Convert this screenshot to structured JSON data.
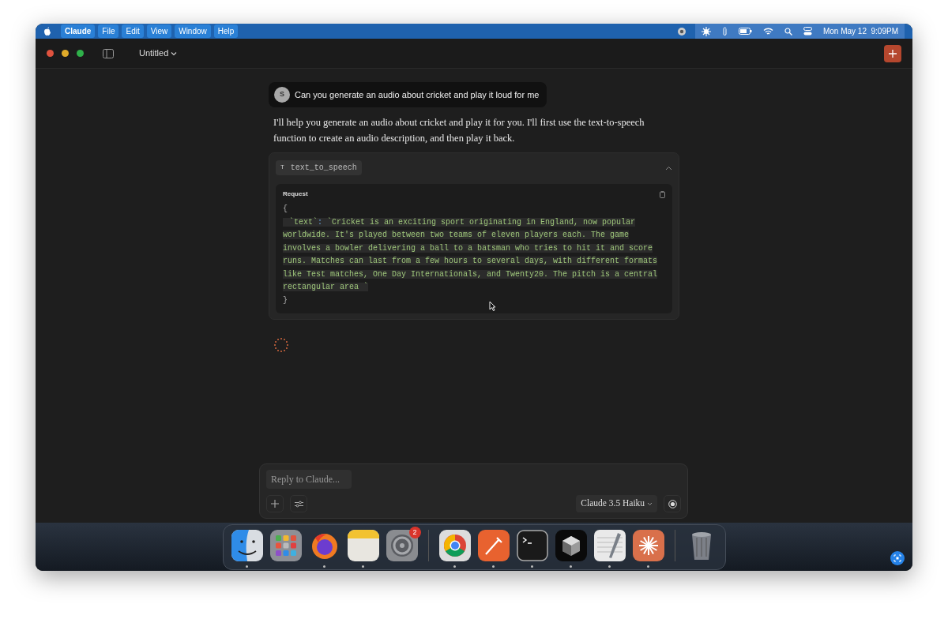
{
  "menu_bar": {
    "menus": [
      {
        "label": "Claude",
        "bold": true
      },
      {
        "label": "File",
        "bold": false
      },
      {
        "label": "Edit",
        "bold": false
      },
      {
        "label": "View",
        "bold": false
      },
      {
        "label": "Window",
        "bold": false
      },
      {
        "label": "Help",
        "bold": false
      }
    ],
    "clock": "Mon May 12  9:09PM"
  },
  "title_bar": {
    "title": "Untitled"
  },
  "conversation": [
    {
      "kind": "user",
      "avatar": "S",
      "text": "Can you generate an audio about cricket and play it loud for me"
    },
    {
      "kind": "assistant",
      "text": "I'll help you generate an audio about cricket and play it for you. I'll first use the text-to-speech function to create an audio description, and then play it back."
    },
    {
      "kind": "tool",
      "badge": "T",
      "name": "text_to_speech",
      "expanded": true,
      "section_label": "Request",
      "open_brace": "{",
      "key": "`text`",
      "separator": ":",
      "value": "`Cricket is an exciting sport originating in England, now popular worldwide. It's played between two teams of eleven players each. The game involves a bowler delivering a ball to a batsman who tries to hit it and score runs. Matches can last from a few hours to several days, with different formats like Test matches, One Day Internationals, and Twenty20. The pitch is a central rectangular area `",
      "close_brace": "}"
    },
    {
      "kind": "spinner"
    }
  ],
  "composer": {
    "placeholder": "Reply to Claude...",
    "model": "Claude 3.5 Haiku"
  },
  "dock": {
    "apps": [
      {
        "kind": "finder",
        "running": true
      },
      {
        "kind": "launchpad",
        "running": false
      },
      {
        "kind": "firefox",
        "running": true
      },
      {
        "kind": "notes",
        "running": true
      },
      {
        "kind": "settings",
        "running": false,
        "badge": "2"
      },
      {
        "kind": "separator"
      },
      {
        "kind": "chrome",
        "running": true
      },
      {
        "kind": "postman",
        "running": true
      },
      {
        "kind": "terminal",
        "running": true
      },
      {
        "kind": "cube",
        "running": true
      },
      {
        "kind": "textedit",
        "running": true
      },
      {
        "kind": "claude",
        "running": true
      },
      {
        "kind": "separator"
      },
      {
        "kind": "trash",
        "running": false
      }
    ]
  }
}
